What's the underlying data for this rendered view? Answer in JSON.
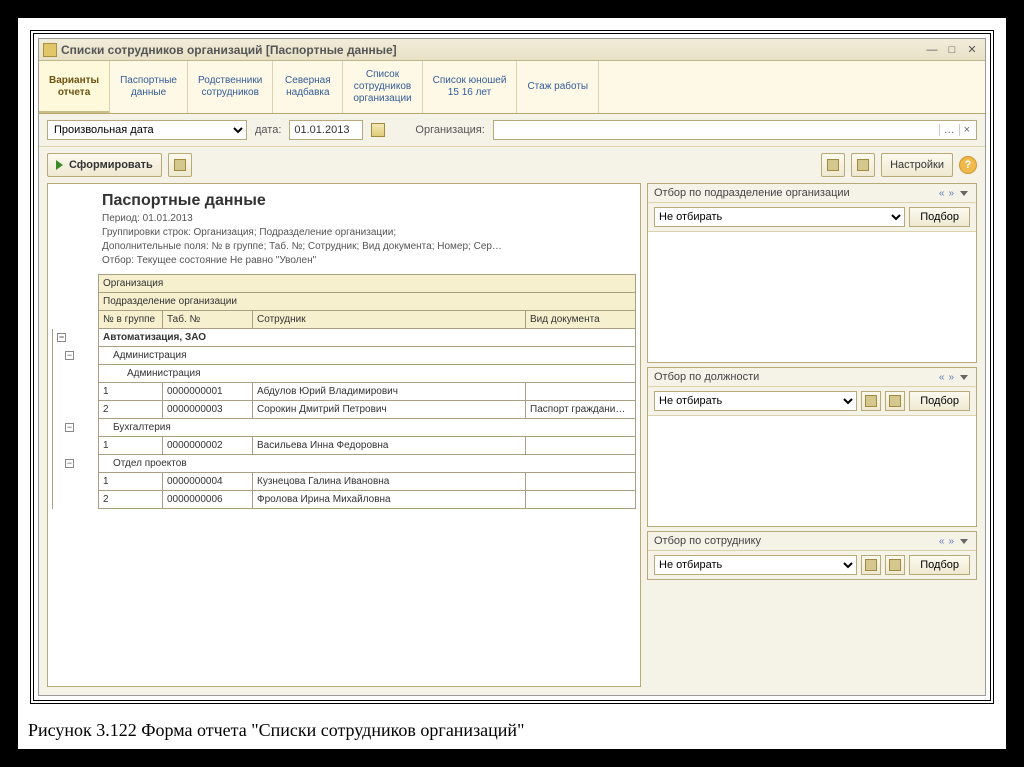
{
  "window": {
    "title": "Списки сотрудников организаций [Паспортные данные]"
  },
  "tabs": [
    {
      "label": "Варианты\nотчета",
      "active": true
    },
    {
      "label": "Паспортные\nданные"
    },
    {
      "label": "Родственники\nсотрудников"
    },
    {
      "label": "Северная\nнадбавка"
    },
    {
      "label": "Список\nсотрудников\nорганизации"
    },
    {
      "label": "Список юношей\n15 16 лет"
    },
    {
      "label": "Стаж работы"
    }
  ],
  "params": {
    "period_mode": "Произвольная дата",
    "date_label": "дата:",
    "date_value": "01.01.2013",
    "org_label": "Организация:",
    "org_value": ""
  },
  "actions": {
    "generate": "Сформировать",
    "settings": "Настройки"
  },
  "report": {
    "title": "Паспортные данные",
    "period": "Период: 01.01.2013",
    "grouping": "Группировки строк: Организация; Подразделение организации;",
    "extra_fields": "Дополнительные поля: № в группе; Таб. №; Сотрудник; Вид документа; Номер; Сер…",
    "filter": "Отбор: Текущее состояние Не равно \"Уволен\""
  },
  "headers": {
    "h1": "Организация",
    "h2": "Подразделение организации",
    "col_num": "№ в группе",
    "col_tab": "Таб. №",
    "col_emp": "Сотрудник",
    "col_doc": "Вид документа"
  },
  "rows": [
    {
      "type": "org",
      "label": "Автоматизация, ЗАО"
    },
    {
      "type": "dep",
      "label": "Администрация"
    },
    {
      "type": "sub",
      "label": "Администрация"
    },
    {
      "type": "data",
      "num": "1",
      "tab": "0000000001",
      "emp": "Абдулов Юрий Владимирович",
      "doc": ""
    },
    {
      "type": "data",
      "num": "2",
      "tab": "0000000003",
      "emp": "Сорокин Дмитрий Петрович",
      "doc": "Паспорт граждани…"
    },
    {
      "type": "dep",
      "label": "Бухгалтерия"
    },
    {
      "type": "data",
      "num": "1",
      "tab": "0000000002",
      "emp": "Васильева Инна Федоровна",
      "doc": ""
    },
    {
      "type": "dep",
      "label": "Отдел проектов"
    },
    {
      "type": "data",
      "num": "1",
      "tab": "0000000004",
      "emp": "Кузнецова Галина Ивановна",
      "doc": ""
    },
    {
      "type": "data",
      "num": "2",
      "tab": "0000000006",
      "emp": "Фролова Ирина Михайловна",
      "doc": ""
    }
  ],
  "filters": {
    "f1_title": "Отбор по подразделение организации",
    "f2_title": "Отбор по должности",
    "f3_title": "Отбор по сотруднику",
    "mode": "Не отбирать",
    "pick": "Подбор"
  },
  "caption": "Рисунок 3.122 Форма отчета \"Списки сотрудников организаций\""
}
